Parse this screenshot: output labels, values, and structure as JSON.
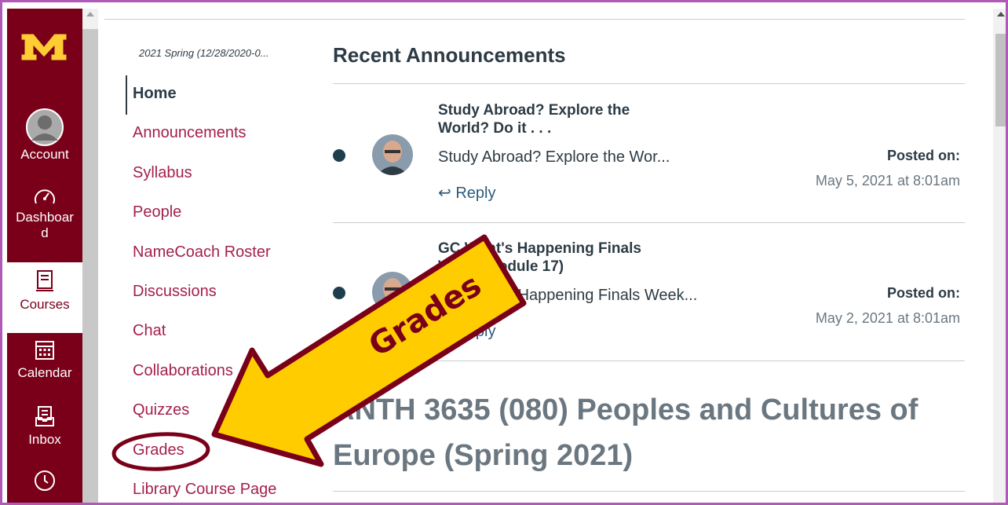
{
  "global_nav": {
    "items": [
      {
        "icon": "account-avatar-icon",
        "label": "Account"
      },
      {
        "icon": "dashboard-icon",
        "label": "Dashboar d"
      },
      {
        "icon": "courses-icon",
        "label": "Courses"
      },
      {
        "icon": "calendar-icon",
        "label": "Calendar"
      },
      {
        "icon": "inbox-icon",
        "label": "Inbox"
      },
      {
        "icon": "history-clock-icon",
        "label": ""
      }
    ],
    "brand_color": "#7a0019",
    "logo_color": "#ffcc33"
  },
  "course_nav": {
    "term": "2021 Spring (12/28/2020-0...",
    "items": [
      "Home",
      "Announcements",
      "Syllabus",
      "People",
      "NameCoach Roster",
      "Discussions",
      "Chat",
      "Collaborations",
      "Quizzes",
      "Grades",
      "Library Course Page"
    ]
  },
  "main": {
    "heading": "Recent Announcements",
    "announcements": [
      {
        "title": "Study Abroad?  Explore the World?  Do it . . .",
        "message": "Study Abroad?  Explore the Wor...",
        "reply": "Reply",
        "posted_label": "Posted on:",
        "posted_date": "May 5, 2021 at 8:01am"
      },
      {
        "title": "GC What's Happening Finals Week (Module 17)",
        "message": "GC What's Happening Finals Week...",
        "reply": "Reply",
        "posted_label": "Posted on:",
        "posted_date": "May 2, 2021 at 8:01am"
      }
    ],
    "course_title": "ANTH 3635 (080) Peoples and Cultures of Europe (Spring 2021)"
  },
  "annotation": {
    "arrow_label": "Grades",
    "arrow_color": "#ffcc00",
    "outline_color": "#7a0019"
  }
}
